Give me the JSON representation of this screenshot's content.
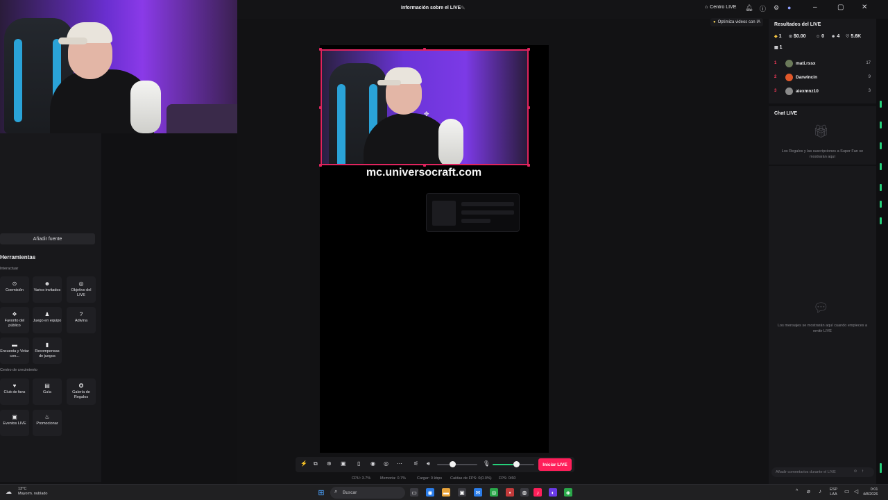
{
  "app": {
    "title": "Información sobre el LIVE",
    "title_edit_icon": "edit-icon",
    "centro_live": "Centro LIVE",
    "accent": "#ff1f5a",
    "green": "#25d07a"
  },
  "left": {
    "add_source": "Añadir fuente",
    "tools_title": "Herramientas",
    "section_interact": "Interactuar",
    "section_growth": "Centro de crecimiento",
    "tools": [
      {
        "label": "Coemisión",
        "icon": "link-icon",
        "glyph": "⊙"
      },
      {
        "label": "Varios invitados",
        "icon": "guests-icon",
        "glyph": "☻"
      },
      {
        "label": "Objetivo del LIVE",
        "icon": "goal-icon",
        "glyph": "◎"
      },
      {
        "label": "Favorito del público",
        "icon": "trophy-icon",
        "glyph": "❖"
      },
      {
        "label": "Juego en equipo",
        "icon": "team-game-icon",
        "glyph": "♟"
      },
      {
        "label": "Adivina",
        "icon": "question-icon",
        "glyph": "?"
      },
      {
        "label": "Encuesta y Votar con...",
        "icon": "poll-icon",
        "glyph": "▬"
      },
      {
        "label": "Recompensas de juegos",
        "icon": "reward-icon",
        "glyph": "▮"
      },
      {
        "label": "Club de fans",
        "icon": "heart-icon",
        "glyph": "♥"
      },
      {
        "label": "Guía",
        "icon": "book-icon",
        "glyph": "▤"
      },
      {
        "label": "Galería de Regalos",
        "icon": "gift-gallery-icon",
        "glyph": "✪"
      },
      {
        "label": "Eventos LIVE",
        "icon": "calendar-icon",
        "glyph": "▣"
      },
      {
        "label": "Promocionar",
        "icon": "flame-icon",
        "glyph": "♨"
      }
    ]
  },
  "stage": {
    "overlay_url": "mc.universocraft.com",
    "optimize": "Optimiza videos con IA",
    "go_live": "Iniciar LIVE",
    "stats": {
      "cpu": "CPU:  3.7%",
      "memory": "Memoria:  0.7%",
      "upload": "Cargar:  0 kbps",
      "dropped": "Caídas de FPS:  0(0.0%)",
      "fps": "FPS:  0/60"
    }
  },
  "right": {
    "results_title": "Resultados del LIVE",
    "metrics": [
      "1",
      "$0.00",
      "0",
      "4",
      "5.6K",
      "1"
    ],
    "ranking": [
      {
        "rank": "1",
        "name": "mati.rssx",
        "score": "17",
        "color": "#6b7a5a"
      },
      {
        "rank": "2",
        "name": "Darwincin",
        "score": "9",
        "color": "#e0582a"
      },
      {
        "rank": "3",
        "name": "alexmnz10",
        "score": "3",
        "color": "#8a8a8a"
      }
    ],
    "chat_title": "Chat LIVE",
    "gifts_empty": "Los Regalos y las suscripciones a Super Fan se mostrarán aquí",
    "messages_empty": "Los mensajes se mostrarán aquí cuando empieces a emitir LIVE",
    "comment_placeholder": "Añadir comentarios durante el LIVE"
  },
  "taskbar": {
    "temp": "13°C",
    "weather": "Mayorm. nublado",
    "search": "Buscar",
    "lang1": "ESP",
    "lang2": "LAA",
    "time": "0:01",
    "date": "4/8/2026"
  }
}
